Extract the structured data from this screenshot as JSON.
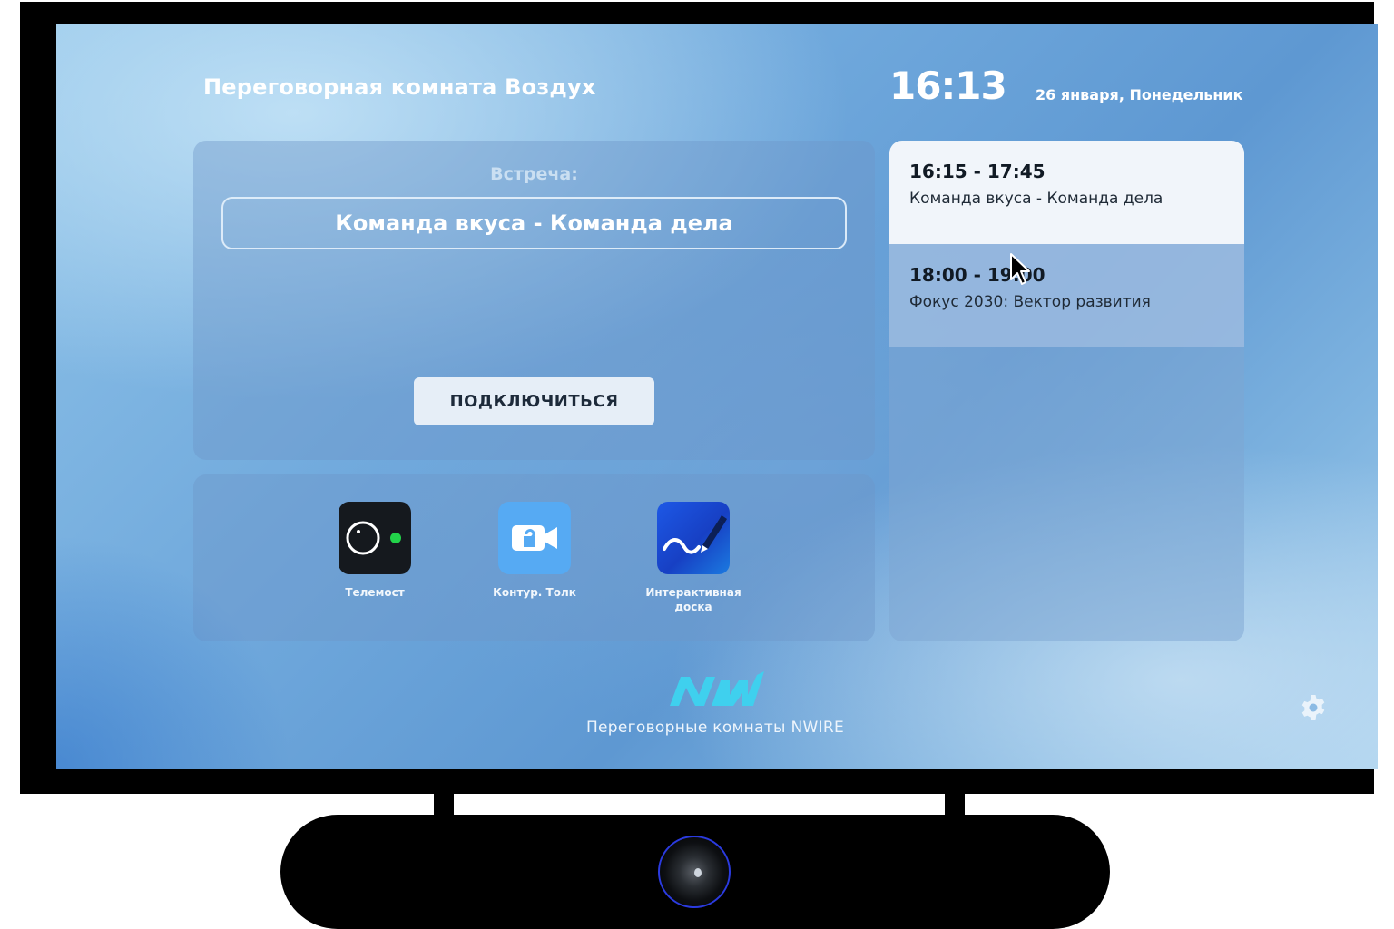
{
  "room": {
    "title": "Переговорная комната Воздух"
  },
  "clock": {
    "time": "16:13",
    "date": "26 января, Понедельник"
  },
  "meeting": {
    "caption": "Встреча:",
    "name": "Команда вкуса - Команда дела",
    "connect_label": "ПОДКЛЮЧИТЬСЯ"
  },
  "apps": [
    {
      "label": "Телемост",
      "icon": "telemost-icon"
    },
    {
      "label": "Контур. Толк",
      "icon": "video-camera-icon"
    },
    {
      "label": "Интерактивная доска",
      "icon": "whiteboard-pen-icon"
    }
  ],
  "schedule": [
    {
      "time": "16:15 - 17:45",
      "title": "Команда вкуса - Команда дела",
      "state": "current"
    },
    {
      "time": "18:00 - 19:00",
      "title": "Фокус 2030: Вектор развития",
      "state": "upcoming"
    }
  ],
  "footer": {
    "brand_logo_text": "NW",
    "brand_caption": "Переговорные комнаты NWIRE",
    "settings_icon": "gear-icon"
  },
  "colors": {
    "accent_cyan": "#3fd0ee",
    "telemost_green": "#22d34a",
    "kontur_blue": "#56aaf3",
    "board_blue": "#1d58e6"
  }
}
